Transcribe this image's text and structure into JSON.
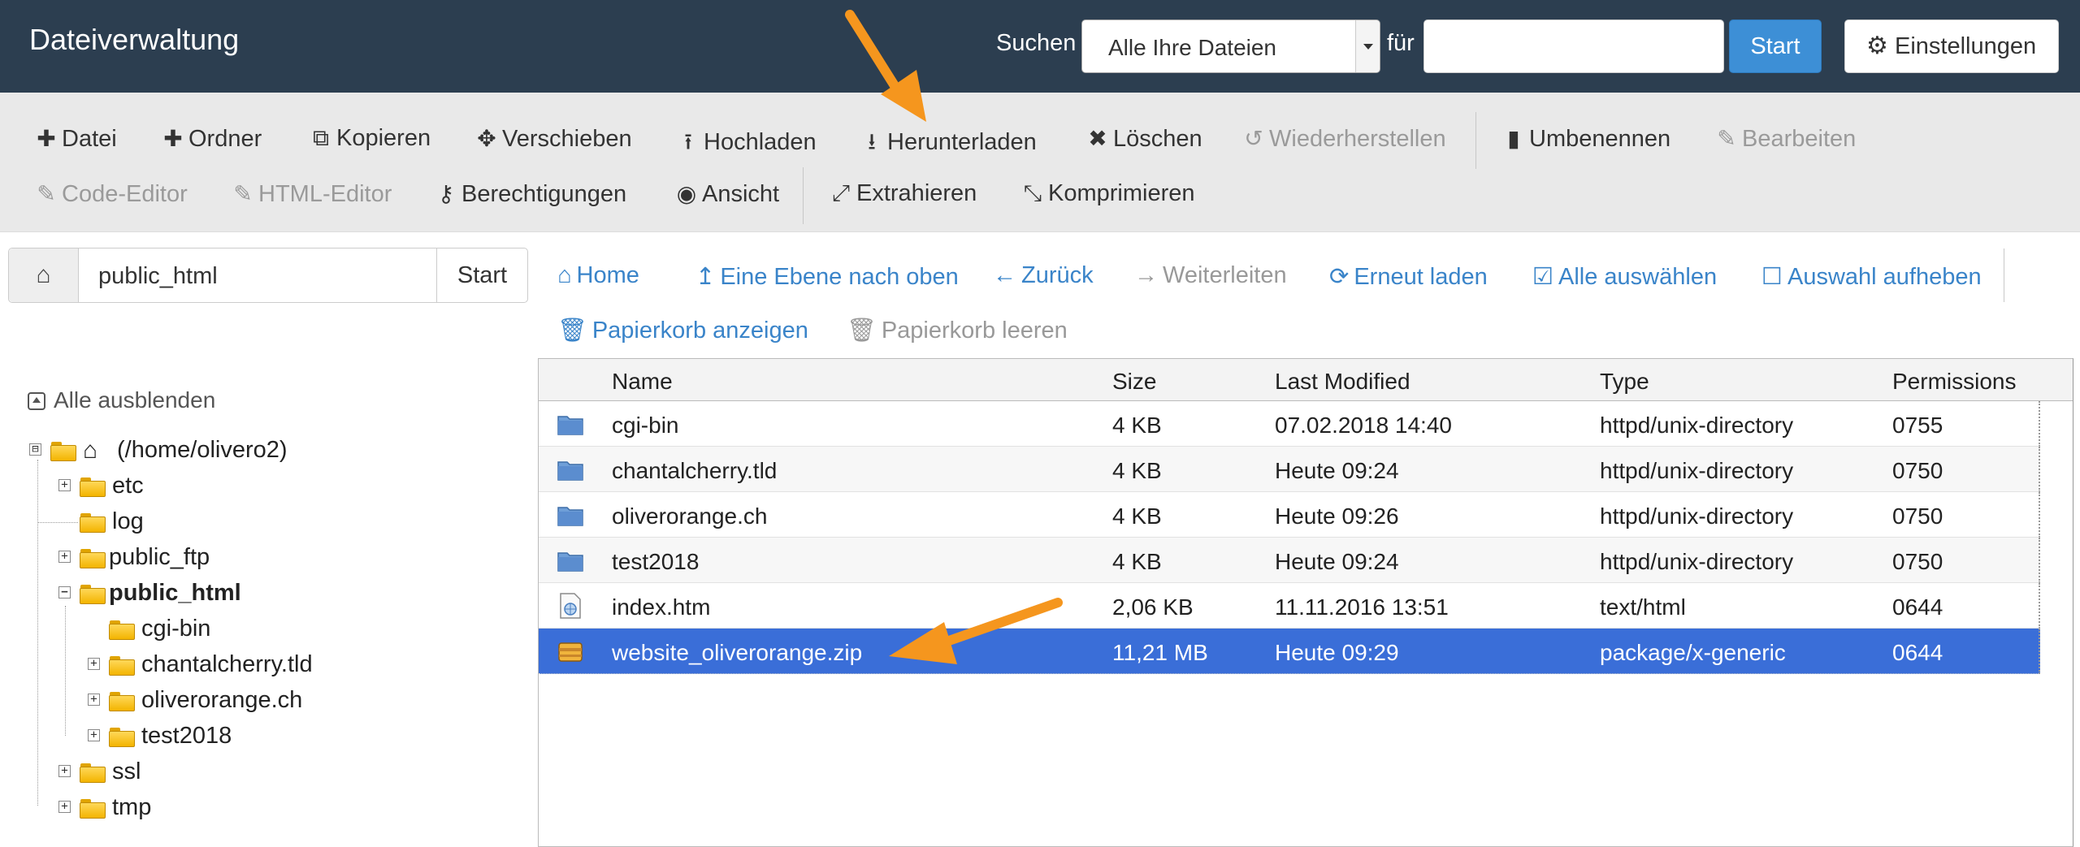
{
  "header": {
    "title": "Dateiverwaltung",
    "search_label": "Suchen",
    "search_scope": "Alle Ihre Dateien",
    "for_label": "für",
    "search_value": "",
    "start_label": "Start",
    "settings_label": "Einstellungen"
  },
  "toolbar": {
    "row1": [
      {
        "label": "Datei",
        "icon": "plus-icon",
        "glyph": "✚",
        "disabled": false
      },
      {
        "label": "Ordner",
        "icon": "plus-icon",
        "glyph": "✚",
        "disabled": false
      },
      {
        "label": "Kopieren",
        "icon": "copy-icon",
        "glyph": "⧉",
        "disabled": false
      },
      {
        "label": "Verschieben",
        "icon": "move-icon",
        "glyph": "✥",
        "disabled": false
      },
      {
        "label": "Hochladen",
        "icon": "upload-icon",
        "glyph": "⭱",
        "disabled": false
      },
      {
        "label": "Herunterladen",
        "icon": "download-icon",
        "glyph": "⭳",
        "disabled": false
      },
      {
        "label": "Löschen",
        "icon": "times-icon",
        "glyph": "✖",
        "disabled": false
      },
      {
        "label": "Wiederherstellen",
        "icon": "undo-icon",
        "glyph": "↺",
        "disabled": true
      },
      {
        "label": "Umbenennen",
        "icon": "file-icon",
        "glyph": "▮",
        "disabled": false
      },
      {
        "label": "Bearbeiten",
        "icon": "pencil-icon",
        "glyph": "✎",
        "disabled": true
      }
    ],
    "row2": [
      {
        "label": "Code-Editor",
        "icon": "edit-icon",
        "glyph": "✎",
        "disabled": true
      },
      {
        "label": "HTML-Editor",
        "icon": "edit-icon",
        "glyph": "✎",
        "disabled": true
      },
      {
        "label": "Berechtigungen",
        "icon": "key-icon",
        "glyph": "⚷",
        "disabled": false
      },
      {
        "label": "Ansicht",
        "icon": "eye-icon",
        "glyph": "◉",
        "disabled": false
      },
      {
        "label": "Extrahieren",
        "icon": "expand-icon",
        "glyph": "⤢",
        "disabled": false
      },
      {
        "label": "Komprimieren",
        "icon": "compress-icon",
        "glyph": "⤡",
        "disabled": false
      }
    ]
  },
  "path_bar": {
    "value": "public_html",
    "go_label": "Start"
  },
  "tree": {
    "collapse_all": "Alle ausblenden",
    "nodes": [
      {
        "label": "(/home/olivero2)",
        "expander": "⊟"
      },
      {
        "label": "etc",
        "expander": "+"
      },
      {
        "label": "log",
        "expander": ""
      },
      {
        "label": "public_ftp",
        "expander": "+"
      },
      {
        "label": "public_html",
        "expander": "−"
      },
      {
        "label": "cgi-bin",
        "expander": ""
      },
      {
        "label": "chantalcherry.tld",
        "expander": "+"
      },
      {
        "label": "oliverorange.ch",
        "expander": "+"
      },
      {
        "label": "test2018",
        "expander": "+"
      },
      {
        "label": "ssl",
        "expander": "+"
      },
      {
        "label": "tmp",
        "expander": "+"
      }
    ]
  },
  "navbar": {
    "home": "Home",
    "up": "Eine Ebene nach oben",
    "back": "Zurück",
    "forward": "Weiterleiten",
    "reload": "Erneut laden",
    "select_all": "Alle auswählen",
    "deselect": "Auswahl aufheben",
    "show_trash": "Papierkorb anzeigen",
    "empty_trash": "Papierkorb leeren"
  },
  "table": {
    "columns": [
      "Name",
      "Size",
      "Last Modified",
      "Type",
      "Permissions"
    ],
    "rows": [
      {
        "name": "cgi-bin",
        "size": "4 KB",
        "modified": "07.02.2018 14:40",
        "type": "httpd/unix-directory",
        "perms": "0755",
        "kind": "folder"
      },
      {
        "name": "chantalcherry.tld",
        "size": "4 KB",
        "modified": "Heute 09:24",
        "type": "httpd/unix-directory",
        "perms": "0750",
        "kind": "folder"
      },
      {
        "name": "oliverorange.ch",
        "size": "4 KB",
        "modified": "Heute 09:26",
        "type": "httpd/unix-directory",
        "perms": "0750",
        "kind": "folder"
      },
      {
        "name": "test2018",
        "size": "4 KB",
        "modified": "Heute 09:24",
        "type": "httpd/unix-directory",
        "perms": "0750",
        "kind": "folder"
      },
      {
        "name": "index.htm",
        "size": "2,06 KB",
        "modified": "11.11.2016 13:51",
        "type": "text/html",
        "perms": "0644",
        "kind": "html"
      },
      {
        "name": "website_oliverorange.zip",
        "size": "11,21 MB",
        "modified": "Heute 09:29",
        "type": "package/x-generic",
        "perms": "0644",
        "kind": "zip"
      }
    ]
  },
  "colors": {
    "header_bg": "#2c3e50",
    "accent": "#3a84c9",
    "selected": "#3a6ed8",
    "arrow": "#f5961e"
  }
}
